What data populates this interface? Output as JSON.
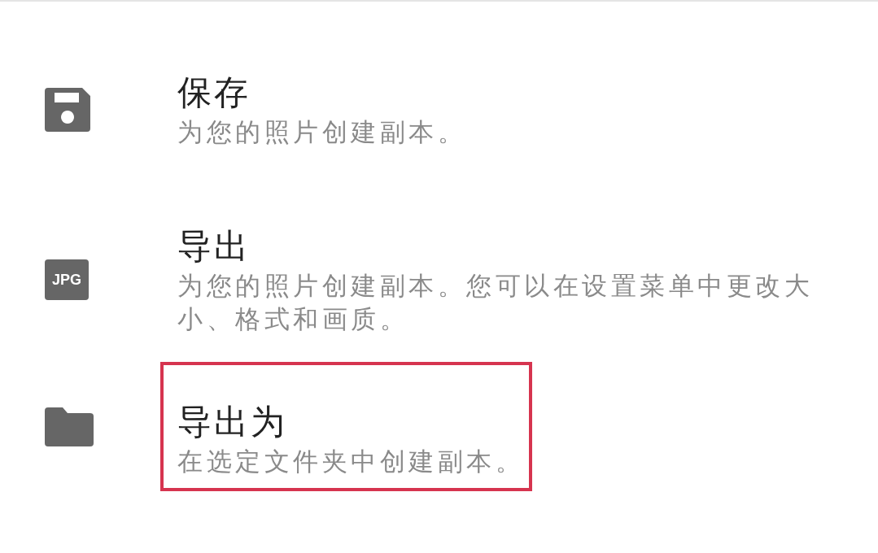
{
  "items": [
    {
      "kind": "save",
      "title": "保存",
      "description": "为您的照片创建副本。",
      "highlighted": false
    },
    {
      "kind": "badge",
      "badge_text": "JPG",
      "title": "导出",
      "description": "为您的照片创建副本。您可以在设置菜单中更改大小、格式和画质。",
      "highlighted": false
    },
    {
      "kind": "folder",
      "title": "导出为",
      "description": "在选定文件夹中创建副本。",
      "highlighted": true
    }
  ]
}
